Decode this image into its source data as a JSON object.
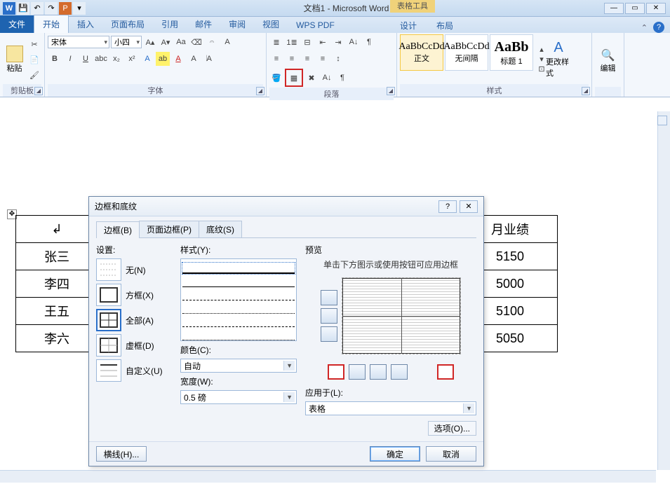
{
  "title": "文档1 - Microsoft Word",
  "context_tab": "表格工具",
  "context_subtabs": [
    "设计",
    "布局"
  ],
  "tabs": {
    "file": "文件",
    "home": "开始",
    "insert": "插入",
    "layout": "页面布局",
    "ref": "引用",
    "mail": "邮件",
    "review": "审阅",
    "view": "视图",
    "wps": "WPS PDF"
  },
  "ribbon": {
    "clipboard": {
      "paste": "粘贴",
      "label": "剪贴板"
    },
    "font": {
      "name": "宋体",
      "size": "小四",
      "label": "字体"
    },
    "paragraph": {
      "label": "段落"
    },
    "styles": {
      "label": "样式",
      "items": [
        {
          "sample": "AaBbCcDd",
          "name": "正文"
        },
        {
          "sample": "AaBbCcDd",
          "name": "无间隔"
        },
        {
          "sample": "AaBb",
          "name": "标题 1"
        }
      ],
      "change": "更改样式"
    },
    "editing": {
      "label": "编辑"
    }
  },
  "doc_table": {
    "header_right": "月业绩",
    "rows": [
      {
        "name": "张三",
        "val": "5150"
      },
      {
        "name": "李四",
        "val": "5000"
      },
      {
        "name": "王五",
        "val": "5100"
      },
      {
        "name": "李六",
        "val": "5050"
      }
    ]
  },
  "dialog": {
    "title": "边框和底纹",
    "tabs": {
      "border": "边框(B)",
      "page": "页面边框(P)",
      "shading": "底纹(S)"
    },
    "settings": {
      "label": "设置:",
      "none": "无(N)",
      "box": "方框(X)",
      "all": "全部(A)",
      "grid": "虚框(D)",
      "custom": "自定义(U)"
    },
    "style": {
      "label": "样式(Y):",
      "color_label": "颜色(C):",
      "color_value": "自动",
      "width_label": "宽度(W):",
      "width_value": "0.5 磅"
    },
    "preview": {
      "label": "预览",
      "hint": "单击下方图示或使用按钮可应用边框",
      "apply_label": "应用于(L):",
      "apply_value": "表格",
      "options": "选项(O)..."
    },
    "footer": {
      "hline": "横线(H)...",
      "ok": "确定",
      "cancel": "取消"
    }
  }
}
